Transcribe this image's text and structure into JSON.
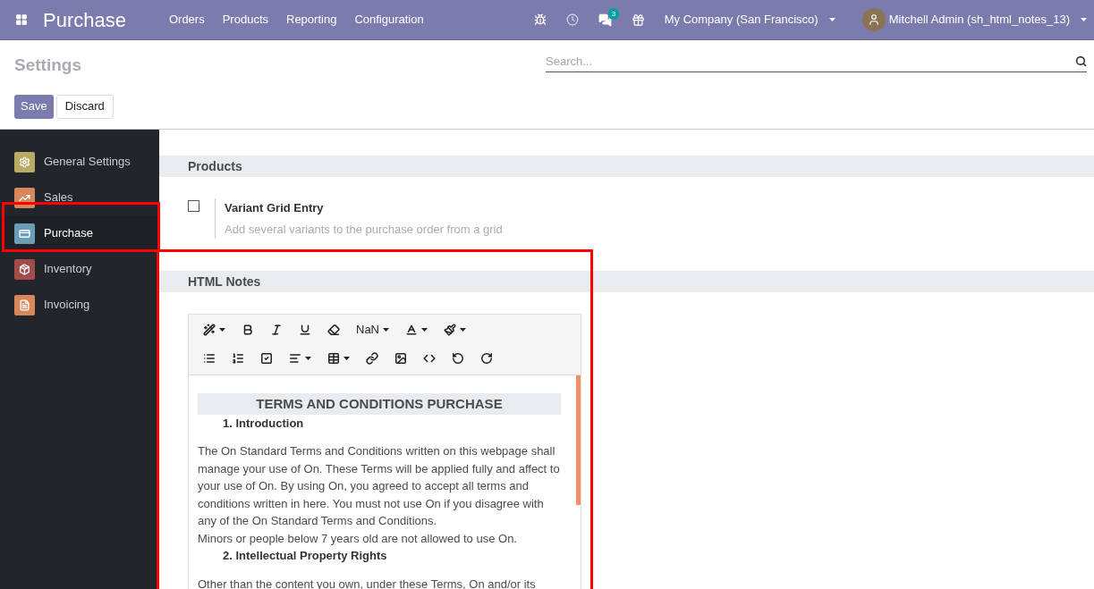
{
  "navbar": {
    "app_title": "Purchase",
    "menu": [
      "Orders",
      "Products",
      "Reporting",
      "Configuration"
    ],
    "messages_count": "3",
    "company": "My Company (San Francisco)",
    "user": "Mitchell Admin (sh_html_notes_13)"
  },
  "control_panel": {
    "title": "Settings",
    "search": {
      "placeholder": "Search..."
    },
    "buttons": [
      {
        "label": "Save",
        "kind": "primary"
      },
      {
        "label": "Discard",
        "kind": "secondary"
      }
    ]
  },
  "sidebar": {
    "items": [
      {
        "label": "General Settings",
        "color": "#b8ac63",
        "selected": false
      },
      {
        "label": "Sales",
        "color": "#d8875a",
        "selected": false
      },
      {
        "label": "Purchase",
        "color": "#6b9cb8",
        "selected": true
      },
      {
        "label": "Inventory",
        "color": "#a34a4a",
        "selected": false
      },
      {
        "label": "Invoicing",
        "color": "#d8875a",
        "selected": false
      }
    ]
  },
  "sections": [
    {
      "title": "Products",
      "settings": [
        {
          "label": "Variant Grid Entry",
          "description": "Add several variants to the purchase order from a grid",
          "checked": false
        }
      ]
    },
    {
      "title": "HTML Notes",
      "editor": {
        "font_size": "NaN",
        "content": [
          {
            "kind": "heading",
            "text": "TERMS AND CONDITIONS PURCHASE"
          },
          {
            "kind": "item",
            "number": "1.",
            "text": "Introduction"
          },
          {
            "kind": "para",
            "text": "The On Standard Terms and Conditions written on this webpage shall manage your use of On. These Terms will be applied fully and affect to your use of On. By using On, you agreed to accept all terms and conditions written in here. You must not use On if you disagree with any of the On Standard Terms and Conditions."
          },
          {
            "kind": "line",
            "text": "Minors or people below 7 years old are not allowed to use On."
          },
          {
            "kind": "item",
            "number": "2.",
            "text": "Intellectual Property Rights"
          },
          {
            "kind": "para",
            "text": "Other than the content you own, under these Terms, On and/or its"
          }
        ]
      }
    }
  ]
}
